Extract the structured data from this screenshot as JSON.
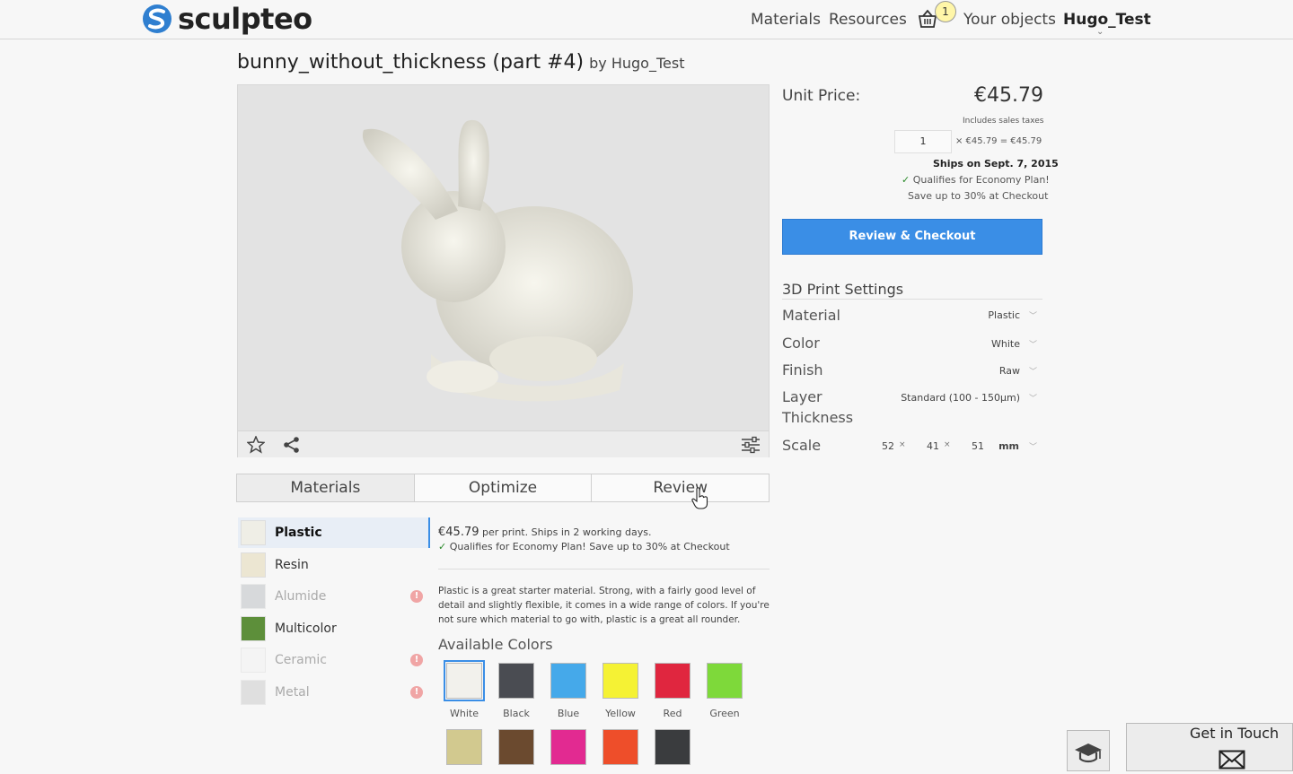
{
  "header": {
    "logo_text": "sculpteo",
    "nav": [
      "Materials",
      "Resources"
    ],
    "cart_count": "1",
    "your_objects": "Your objects",
    "user": "Hugo_Test"
  },
  "object": {
    "title": "bunny_without_thickness (part #4)",
    "by": "by Hugo_Test"
  },
  "tabs": [
    "Materials",
    "Optimize",
    "Review"
  ],
  "materials": [
    {
      "label": "Plastic",
      "color": "#efeee6",
      "selected": true,
      "disabled": false
    },
    {
      "label": "Resin",
      "color": "#ece6d2",
      "selected": false,
      "disabled": false
    },
    {
      "label": "Alumide",
      "color": "#b9bdc0",
      "selected": false,
      "disabled": true
    },
    {
      "label": "Multicolor",
      "color": "#5d8f3a",
      "selected": false,
      "disabled": false
    },
    {
      "label": "Ceramic",
      "color": "#f2f2f2",
      "selected": false,
      "disabled": true
    },
    {
      "label": "Metal",
      "color": "#c9c9c9",
      "selected": false,
      "disabled": true
    }
  ],
  "detail": {
    "price": "€45.79",
    "price_suffix": "per print. Ships in 2 working days.",
    "economy": "Qualifies for Economy Plan! Save up to 30% at Checkout",
    "description": "Plastic is a great starter material. Strong, with a fairly good level of detail and slightly flexible, it comes in a wide range of colors. If you're not sure which material to go with, plastic is a great all rounder.",
    "available_colors_title": "Available Colors",
    "colors": [
      {
        "label": "White",
        "hex": "#f2f1ec"
      },
      {
        "label": "Black",
        "hex": "#4a4c52"
      },
      {
        "label": "Blue",
        "hex": "#45a9ea"
      },
      {
        "label": "Yellow",
        "hex": "#f5f234"
      },
      {
        "label": "Red",
        "hex": "#e0263f"
      },
      {
        "label": "Green",
        "hex": "#7ed93a"
      }
    ],
    "colors_row2": [
      {
        "hex": "#d2c98f"
      },
      {
        "hex": "#6b4a2f"
      },
      {
        "hex": "#e22a91"
      },
      {
        "hex": "#ee4e2a"
      },
      {
        "hex": "#3a3c3e"
      }
    ]
  },
  "pricing": {
    "unit_price_label": "Unit Price:",
    "unit_price": "€45.79",
    "includes_taxes": "Includes sales taxes",
    "quantity": "1",
    "calc": "× €45.79 = €45.79",
    "ships_on": "Ships on Sept. 7, 2015",
    "qualifies": "Qualifies for Economy Plan!",
    "save": "Save up to 30% at Checkout",
    "checkout_button": "Review & Checkout"
  },
  "settings": {
    "title": "3D Print Settings",
    "material_label": "Material",
    "material_value": "Plastic",
    "color_label": "Color",
    "color_value": "White",
    "finish_label": "Finish",
    "finish_value": "Raw",
    "layer_label_1": "Layer",
    "layer_label_2": "Thickness",
    "layer_value": "Standard (100 - 150µm)",
    "scale_label": "Scale",
    "scale_x": "52",
    "scale_y": "41",
    "scale_z": "51",
    "scale_unit": "mm",
    "times": "×"
  },
  "footer": {
    "get_in_touch": "Get in Touch"
  }
}
